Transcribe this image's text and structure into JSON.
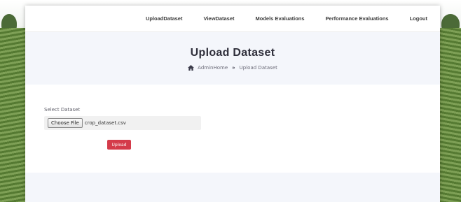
{
  "nav": {
    "items": [
      {
        "label": "UploadDataset"
      },
      {
        "label": "ViewDataset"
      },
      {
        "label": "Models Evaluations"
      },
      {
        "label": "Performance Evaluations"
      },
      {
        "label": "Logout"
      }
    ]
  },
  "hero": {
    "title": "Upload Dataset",
    "breadcrumb": {
      "home_icon": "home-icon",
      "home_label": "AdminHome",
      "separator_icon": "double-chevron-right-icon",
      "current_label": "Upload Dataset"
    }
  },
  "form": {
    "label": "Select Dataset",
    "choose_button": "Choose File",
    "file_name": "crop_dataset.csv",
    "upload_button": "Upload",
    "upload_color": "#d43b4a"
  }
}
